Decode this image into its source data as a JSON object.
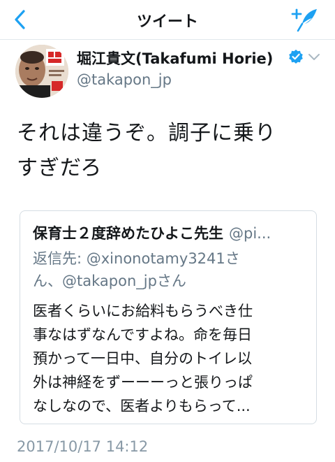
{
  "navbar": {
    "title": "ツイート",
    "back_icon": "chevron-left-icon",
    "compose_icon": "compose-tweet-icon",
    "accent_color": "#1da1f2"
  },
  "tweet": {
    "author_name": "堀江貴文(Takafumi Horie)",
    "author_handle": "@takapon_jp",
    "verified": true,
    "verified_icon": "verified-badge-icon",
    "menu_icon": "chevron-down-icon",
    "text_line_1": "それは違うぞ。調子に乗り",
    "text_line_2": "すぎだろ",
    "timestamp": "2017/10/17 14:12"
  },
  "quoted_tweet": {
    "author_name": "保育士２度辞めたひよこ先生",
    "author_handle": "@pi...",
    "reply_to_line_1": "返信先: @xinonotamy3241さ",
    "reply_to_line_2": "ん、@takapon_jpさん",
    "text_lines": [
      "医者くらいにお給料もらうべき仕",
      "事なはずなんですよね。命を毎日",
      "預かって一日中、自分のトイレ以",
      "外は神経をずーーーっと張りっぱ",
      "なしなので、医者よりもらって..."
    ]
  }
}
